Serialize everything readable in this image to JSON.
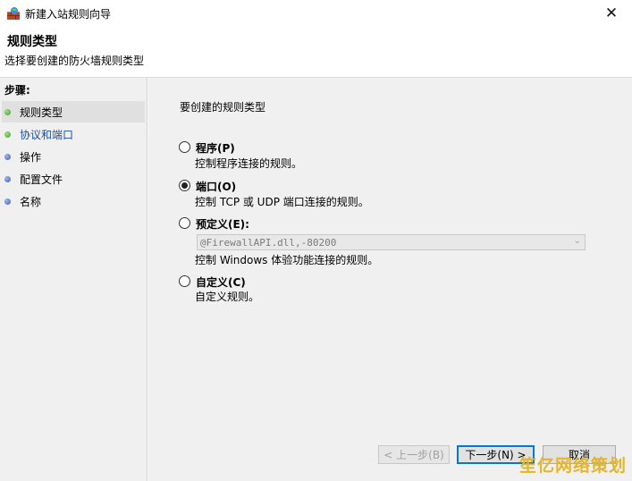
{
  "window": {
    "title": "新建入站规则向导",
    "close_symbol": "✕"
  },
  "header": {
    "title": "规则类型",
    "subtitle": "选择要创建的防火墙规则类型"
  },
  "sidebar": {
    "heading": "步骤:",
    "items": [
      {
        "label": "规则类型",
        "dot": "green",
        "active": true
      },
      {
        "label": "协议和端口",
        "dot": "green",
        "active": false
      },
      {
        "label": "操作",
        "dot": "blue",
        "active": false
      },
      {
        "label": "配置文件",
        "dot": "blue",
        "active": false
      },
      {
        "label": "名称",
        "dot": "blue",
        "active": false
      }
    ]
  },
  "main": {
    "question": "要创建的规则类型",
    "options": [
      {
        "label": "程序(P)",
        "desc": "控制程序连接的规则。",
        "checked": false
      },
      {
        "label": "端口(O)",
        "desc": "控制 TCP 或 UDP 端口连接的规则。",
        "checked": true
      },
      {
        "label": "预定义(E):",
        "desc": "控制 Windows 体验功能连接的规则。",
        "checked": false
      },
      {
        "label": "自定义(C)",
        "desc": "自定义规则。",
        "checked": false
      }
    ],
    "predefined_select": {
      "value": "@FirewallAPI.dll,-80200"
    }
  },
  "buttons": {
    "back": "< 上一步(B)",
    "next": "下一步(N) >",
    "cancel": "取消"
  },
  "watermark": "笙亿网络策划"
}
